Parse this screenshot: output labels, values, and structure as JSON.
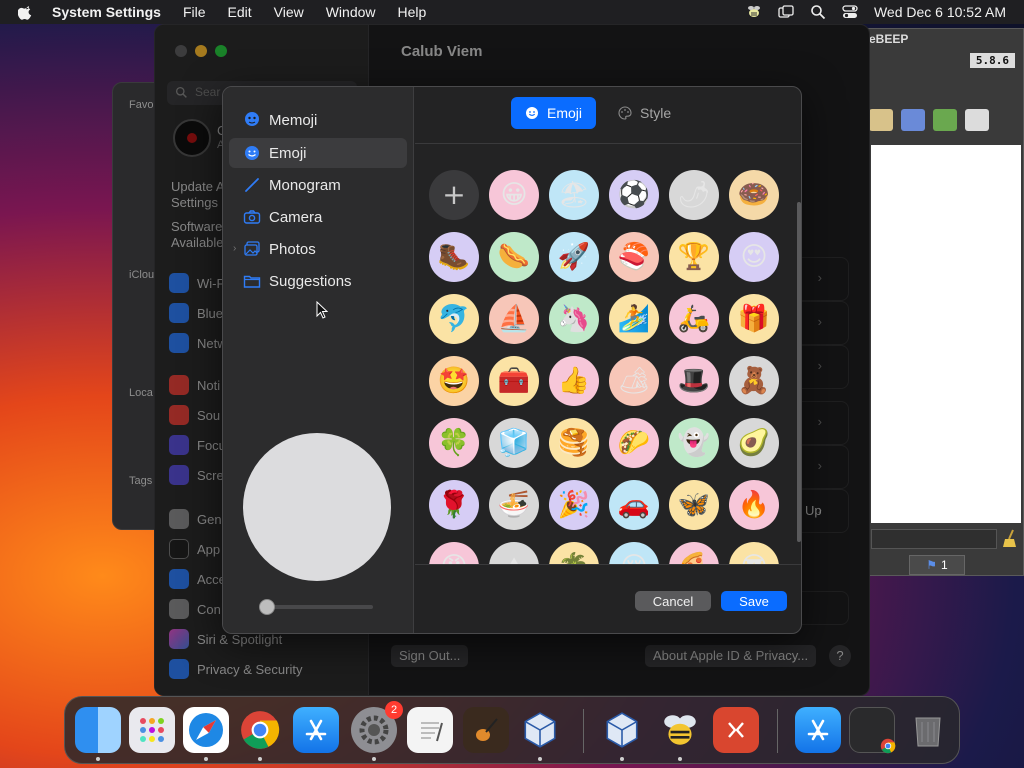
{
  "menubar": {
    "app_name": "System Settings",
    "menus": [
      "File",
      "Edit",
      "View",
      "Window",
      "Help"
    ],
    "datetime": "Wed Dec 6  10:52 AM"
  },
  "back_window": {
    "labels": [
      "Favo",
      "iClou",
      "Loca",
      "Tags"
    ]
  },
  "beep_window": {
    "title": "eBEEP",
    "version": "5.8.6",
    "tab_label": "1"
  },
  "settings_window": {
    "search_placeholder": "Sear",
    "main_title": "Calub Viem",
    "avatar_caption": [
      "C",
      "A"
    ],
    "update_text": "Update A\nSettings",
    "software_text": "Software\nAvailable",
    "sidebar_items": [
      "Wi-F",
      "Blue",
      "Netw",
      "Noti",
      "Sou",
      "Focu",
      "Scre",
      "Gen",
      "App",
      "Acce",
      "Con",
      "Siri & Spotlight",
      "Privacy & Security"
    ],
    "up_label": "Up",
    "sign_out": "Sign Out...",
    "about": "About Apple ID & Privacy...",
    "help": "?"
  },
  "sheet": {
    "sources": [
      {
        "label": "Memoji"
      },
      {
        "label": "Emoji"
      },
      {
        "label": "Monogram"
      },
      {
        "label": "Camera"
      },
      {
        "label": "Photos"
      },
      {
        "label": "Suggestions"
      }
    ],
    "selected_source": "Emoji",
    "tabs": [
      {
        "label": "Emoji",
        "active": true
      },
      {
        "label": "Style",
        "active": false
      }
    ],
    "add_symbol": "+",
    "emoji_rows": [
      [
        "😀",
        "🏖",
        "⚽",
        "🌶",
        "🍩"
      ],
      [
        "🥾",
        "🌭",
        "🚀",
        "🍣",
        "🏆",
        "😍"
      ],
      [
        "🐬",
        "⛵",
        "🦄",
        "🏄",
        "🛵",
        "🎁"
      ],
      [
        "🤩",
        "🧰",
        "👍",
        "🏕",
        "🎩",
        "🧸"
      ],
      [
        "🍀",
        "🧊",
        "🥞",
        "🌮",
        "👻",
        "🥑"
      ],
      [
        "🌹",
        "🍜",
        "🎉",
        "🚗",
        "🦋",
        "🔥"
      ],
      [
        "😡",
        "⛰",
        "🌴",
        "😢",
        "🍕",
        "😎"
      ]
    ],
    "emoji_bg": [
      [
        "#f7c6d8",
        "#bfe6f7",
        "#d6cdf5",
        "#d8d8d8",
        "#f5d9a8"
      ],
      [
        "#d6cdf5",
        "#bfe9c9",
        "#bfe6f7",
        "#f7c6b8",
        "#fbe3a5",
        "#d6cdf5"
      ],
      [
        "#fbe3a5",
        "#f7c6b8",
        "#bfe9c9",
        "#fbe3a5",
        "#f7c6d8",
        "#fbe3a5"
      ],
      [
        "#fbd3a5",
        "#fbe3a5",
        "#f7c6d8",
        "#f7c6b8",
        "#f7c6d8",
        "#d8d8d8"
      ],
      [
        "#f7c6d8",
        "#d8d8d8",
        "#fbe3a5",
        "#f7c6d8",
        "#bfe9c9",
        "#d8d8d8"
      ],
      [
        "#d6cdf5",
        "#d8d8d8",
        "#d6cdf5",
        "#bfe6f7",
        "#fbe3a5",
        "#f7c6d8"
      ],
      [
        "#f7c6d8",
        "#d8d8d8",
        "#fbe3a5",
        "#bfe6f7",
        "#f7c6d8",
        "#fbe3a5"
      ]
    ],
    "cancel_label": "Cancel",
    "save_label": "Save",
    "accent": "#0a6cff"
  },
  "dock": {
    "apps": [
      "Finder",
      "Launchpad",
      "Safari",
      "Chrome",
      "App Store",
      "System Settings",
      "TextEdit",
      "GarageBand",
      "VirtualBox",
      "VirtualBox VM",
      "Cocktail",
      "Remote Desktop",
      "App Store Installer",
      "Chrome Window",
      "Trash"
    ],
    "settings_badge": "2"
  }
}
